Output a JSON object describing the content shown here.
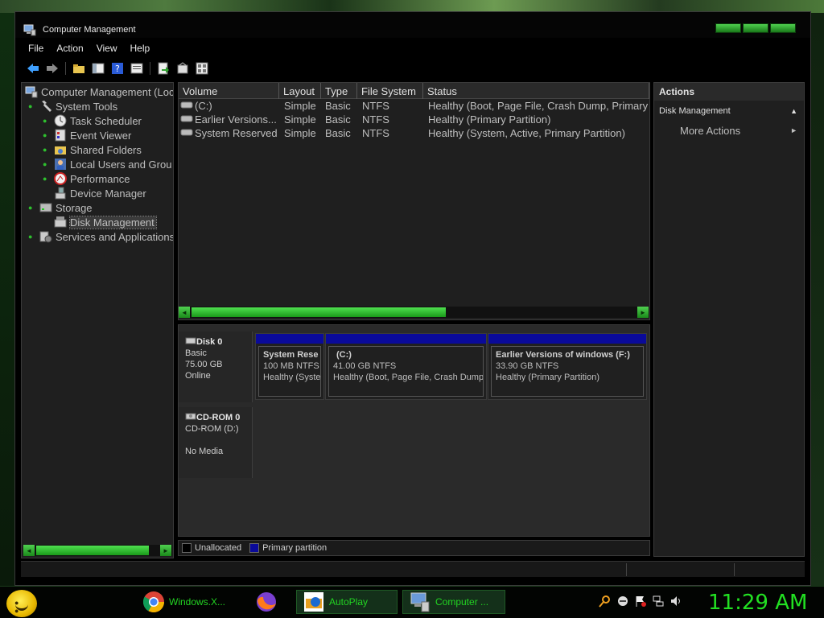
{
  "window": {
    "title": "Computer Management"
  },
  "menu": [
    "File",
    "Action",
    "View",
    "Help"
  ],
  "toolbar_icons": [
    "back-icon",
    "forward-icon",
    "up-folder-icon",
    "show-hide-tree-icon",
    "help-icon",
    "properties-icon",
    "export-icon",
    "refresh-icon",
    "view-icon"
  ],
  "tree": {
    "root": "Computer Management (Loc",
    "system_tools": "System Tools",
    "task_scheduler": "Task Scheduler",
    "event_viewer": "Event Viewer",
    "shared_folders": "Shared Folders",
    "local_users": "Local Users and Grou",
    "performance": "Performance",
    "device_manager": "Device Manager",
    "storage": "Storage",
    "disk_management": "Disk Management",
    "services": "Services and Applications"
  },
  "volumes": {
    "columns": [
      "Volume",
      "Layout",
      "Type",
      "File System",
      "Status"
    ],
    "rows": [
      {
        "volume": "(C:)",
        "layout": "Simple",
        "type": "Basic",
        "fs": "NTFS",
        "status": "Healthy (Boot, Page File, Crash Dump, Primary"
      },
      {
        "volume": "Earlier Versions...",
        "layout": "Simple",
        "type": "Basic",
        "fs": "NTFS",
        "status": "Healthy (Primary Partition)"
      },
      {
        "volume": "System Reserved",
        "layout": "Simple",
        "type": "Basic",
        "fs": "NTFS",
        "status": "Healthy (System, Active, Primary Partition)"
      }
    ]
  },
  "disk0": {
    "name": "Disk 0",
    "kind": "Basic",
    "size": "75.00 GB",
    "state": "Online",
    "partitions": [
      {
        "name": "System Rese",
        "size": "100 MB NTFS",
        "status": "Healthy (Syste"
      },
      {
        "name": "(C:)",
        "size": "41.00 GB NTFS",
        "status": "Healthy (Boot, Page File, Crash Dump, I"
      },
      {
        "name": "Earlier Versions of windows  (F:)",
        "size": "33.90 GB NTFS",
        "status": "Healthy (Primary Partition)"
      }
    ]
  },
  "cdrom0": {
    "name": "CD-ROM 0",
    "drive": "CD-ROM (D:)",
    "media": "No Media"
  },
  "legend": {
    "unallocated": "Unallocated",
    "primary": "Primary partition",
    "unallocated_color": "#000000",
    "primary_color": "#0a0a9a"
  },
  "actions": {
    "header": "Actions",
    "section": "Disk Management",
    "more": "More Actions"
  },
  "taskbar": {
    "items": [
      {
        "label": "Windows.X...",
        "icon": "chrome-icon"
      },
      {
        "label": "",
        "icon": "firefox-icon"
      },
      {
        "label": "AutoPlay",
        "icon": "autoplay-icon"
      },
      {
        "label": "Computer ...",
        "icon": "computer-management-icon"
      }
    ],
    "clock": "11:29 AM"
  },
  "colors": {
    "accent": "#22e022",
    "partition_bar": "#0a0a9a"
  }
}
